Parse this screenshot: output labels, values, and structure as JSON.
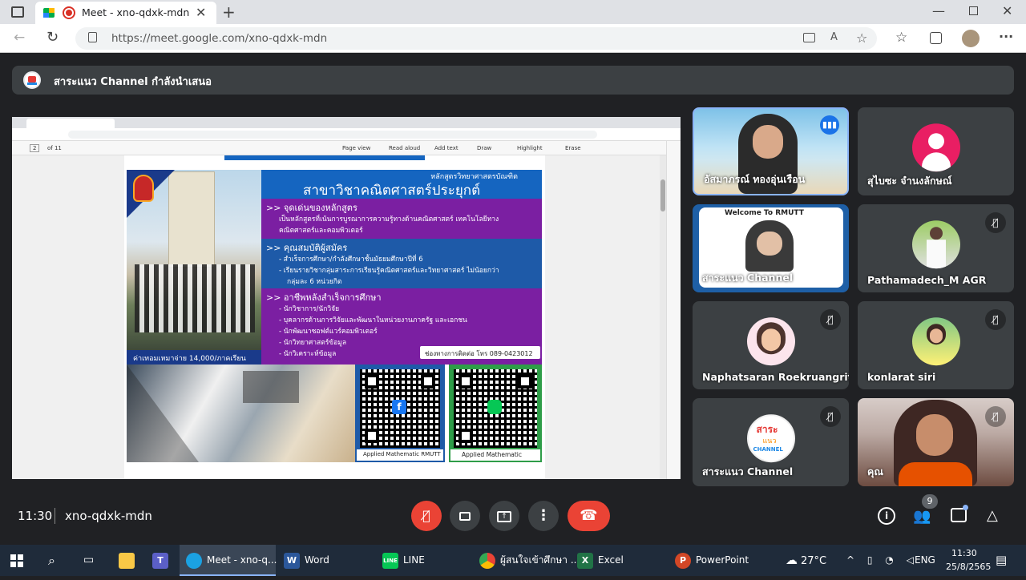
{
  "browser": {
    "tab_title": "Meet - xno-qdxk-mdn",
    "url": "https://meet.google.com/xno-qdxk-mdn"
  },
  "banner": {
    "text": "สาระแนว Channel กำลังนำเสนอ"
  },
  "presentation": {
    "toolbar": {
      "page": "2",
      "of": "of 11",
      "page_view": "Page view",
      "read_aloud": "Read aloud",
      "add_text": "Add text",
      "draw": "Draw",
      "highlight": "Highlight",
      "erase": "Erase"
    },
    "poster": {
      "program_sub": "หลักสูตรวิทยาศาสตรบัณฑิต",
      "program_title": "สาขาวิชาคณิตศาสตร์ประยุกต์",
      "s1_head": ">> จุดเด่นของหลักสูตร",
      "s1_l1": "เป็นหลักสูตรที่เน้นการบูรณาการความรู้ทางด้านคณิตศาสตร์ เทคโนโลยีทาง",
      "s1_l2": "คณิตศาสตร์และคอมพิวเตอร์",
      "s2_head": ">> คุณสมบัติผู้สมัคร",
      "s2_l1": "- สำเร็จการศึกษา/กำลังศึกษาชั้นมัธยมศึกษาปีที่ 6",
      "s2_l2": "- เรียนรายวิชากลุ่มสาระการเรียนรู้คณิตศาสตร์และวิทยาศาสตร์ ไม่น้อยกว่า",
      "s2_l3": "กลุ่มละ 6 หน่วยกิต",
      "s3_head": ">> อาชีพหลังสำเร็จการศึกษา",
      "careers": [
        "- นักวิชาการ/นักวิจัย",
        "- บุคลากรด้านการวิจัยและพัฒนาในหน่วยงานภาครัฐ และเอกชน",
        "- นักพัฒนาซอฟต์แวร์คอมพิวเตอร์",
        "- นักวิทยาศาสตร์ข้อมูล",
        "- นักวิเคราะห์ข้อมูล"
      ],
      "fee": "ค่าเทอมเหมาจ่าย 14,000/ภาคเรียน",
      "contact": "ช่องทางการติดต่อ โทร 089-0423012",
      "qr1_label": "Applied Mathematic RMUTT",
      "qr2_label": "Applied Mathematic"
    }
  },
  "participants": [
    {
      "name": "อัสมาภรณ์ ทองอุ่นเรือน",
      "speaking": true
    },
    {
      "name": "สุไบซะ จำนงลักษณ์",
      "initial": ""
    },
    {
      "name": "สาระแนว Channel",
      "frame_text": "Welcome To RMUTT"
    },
    {
      "name": "Pathamadech_M AGR"
    },
    {
      "name": "Naphatsaran Roekruangrit"
    },
    {
      "name": "konlarat siri"
    },
    {
      "name": "สาระแนว Channel",
      "logo_text": [
        "สาระ",
        "แนว",
        "CHANNEL"
      ]
    },
    {
      "name": "คุณ"
    }
  ],
  "meeting": {
    "time": "11:30",
    "code": "xno-qdxk-mdn",
    "people_count": "9"
  },
  "colors": {
    "end_call": "#ea4335",
    "mic_off": "#ea4335",
    "speaking": "#8ab4f8"
  },
  "taskbar": {
    "apps": [
      "Meet - xno-q...",
      "Word",
      "LINE",
      "ผู้สนใจเข้าศึกษา ...",
      "Excel",
      "PowerPoint"
    ],
    "weather": "27°C",
    "lang": "ENG",
    "time": "11:30",
    "date": "25/8/2565"
  }
}
